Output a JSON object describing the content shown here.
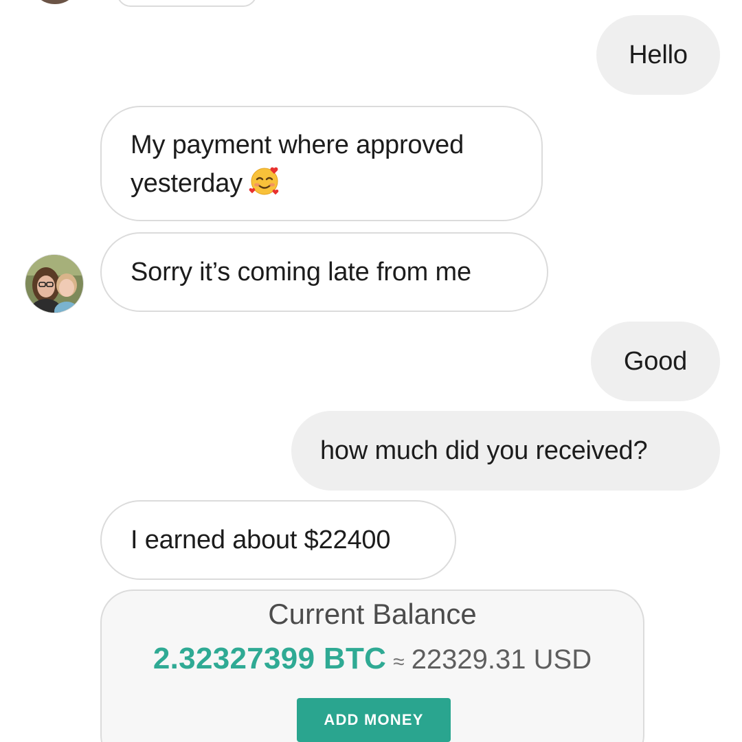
{
  "messages": [
    {
      "id": "hello",
      "direction": "outgoing",
      "text": "Hello"
    },
    {
      "id": "approved",
      "direction": "incoming",
      "text": "My payment where approved yesterday",
      "emoji": "smiling-face-with-hearts-emoji"
    },
    {
      "id": "sorry",
      "direction": "incoming",
      "text": "Sorry it’s coming late from me"
    },
    {
      "id": "good",
      "direction": "outgoing",
      "text": "Good"
    },
    {
      "id": "howmuch",
      "direction": "outgoing",
      "text": "how much did you received?"
    },
    {
      "id": "earned",
      "direction": "incoming",
      "text": "I earned about $22400"
    }
  ],
  "balance_card": {
    "title": "Current Balance",
    "btc_amount": "2.32327399 BTC",
    "approx_symbol": "≈",
    "usd_amount": "22329.31 USD",
    "button_label": "ADD MONEY"
  },
  "colors": {
    "outgoing_bubble": "#efefef",
    "incoming_border": "#dbdbdb",
    "btc_green": "#2faa94",
    "button_green": "#2aa58f"
  }
}
